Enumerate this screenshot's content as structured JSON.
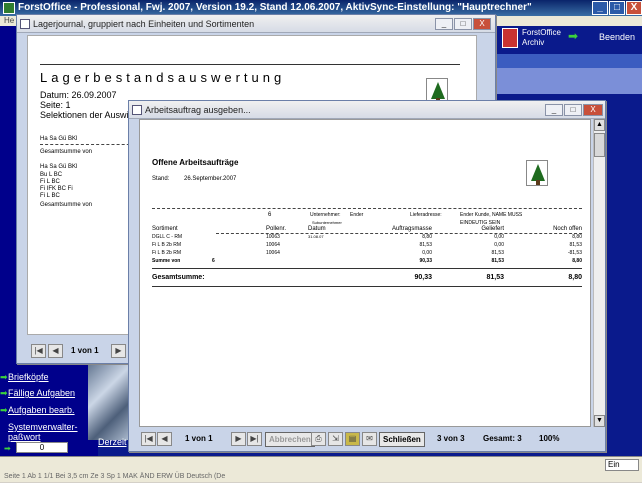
{
  "app": {
    "title": "ForstOffice - Professional, Fwj. 2007, Version 19.2, Stand 12.06.2007, AktivSync-Einstellung: \"Hauptrechner\"",
    "menu_fragment": "He",
    "window_controls": [
      "_",
      "□",
      "X"
    ]
  },
  "top_right": {
    "archive_label": "ForstOffice Archiv",
    "quit_label": "Beenden"
  },
  "sidebar": {
    "items": [
      {
        "label": "Briefköpfe"
      },
      {
        "label": "Fällige Aufgaben"
      },
      {
        "label": "Aufgaben bearb."
      },
      {
        "label": "Systemverwalter-paßwort"
      }
    ],
    "password_value": "0",
    "derzeit_label": "Derzeit"
  },
  "status": {
    "ein_label": "Ein",
    "cells": "Seite 1     Ab 1     1/1     Bei 3,5 cm     Ze 3     Sp 1     MAK  ÄND  ERW  ÜB     Deutsch (De"
  },
  "back_window": {
    "title": "Lagerjournal, gruppiert nach Einheiten und Sortimenten",
    "report_title": "Lagerbestandsauswertung",
    "date_line": "Datum: 26.09.2007",
    "page_line": "Seite:  1",
    "selection_line": "Selektionen der Auswi",
    "header_row": "Ha     Sa     Gü     BKl",
    "sum_row": "Gesamtsumme          von",
    "row_lines": [
      "Ha     Sa     Gü     BKl",
      "Bu     L      BC",
      "Fi      L      BC",
      "Fi      IFK   BC     Fi",
      "Fi      L      BC"
    ],
    "sum_row2": "Gesamtsumme          von",
    "pager": "1 von 1"
  },
  "front_window": {
    "title": "Arbeitsauftrag ausgeben...",
    "report": {
      "title": "Offene Arbeitsaufträge",
      "stand_label": "Stand:",
      "stand_value": "26.September.2007",
      "group_no": "6",
      "unternehmer_label": "Unternehmer:",
      "unternehmer_value": "Ender",
      "sub_label": "Subunternehmer",
      "lieferadresse_label": "Lieferadresse:",
      "lieferadresse_value": "Ender Kunde, NAME MUSS",
      "lieferadresse_value2": "EINDEUTIG SEIN",
      "columns": [
        "Sortiment",
        "Pollenr.",
        "Datum",
        "Auftragsmasse",
        "Geliefert",
        "Noch offen"
      ],
      "rows": [
        {
          "sortiment": "DGLL  C  -  RM",
          "pollenr": "10063",
          "datum": "31.08.07",
          "auftrag": "8,80",
          "geliefert": "0,00",
          "offen": "8,80"
        },
        {
          "sortiment": "Fi L  B  2b  RM",
          "pollenr": "10064",
          "datum": "",
          "auftrag": "81,53",
          "geliefert": "0,00",
          "offen": "81,53"
        },
        {
          "sortiment": "Fi L  B  2b  RM",
          "pollenr": "10064",
          "datum": "",
          "auftrag": "0,00",
          "geliefert": "81,53",
          "offen": "-81,53"
        }
      ],
      "sum_label": "Summe  von",
      "sum_group": "6",
      "sum_values": [
        "90,33",
        "81,53",
        "8,80"
      ],
      "total_label": "Gesamtsumme:",
      "total_values": [
        "90,33",
        "81,53",
        "8,80"
      ]
    },
    "toolbar": {
      "pager": "1 von 1",
      "close_label": "Abbrechen",
      "schliessen_label": "Schließen",
      "page_count": "3 von 3",
      "total": "Gesamt: 3",
      "zoom": "100%"
    }
  }
}
